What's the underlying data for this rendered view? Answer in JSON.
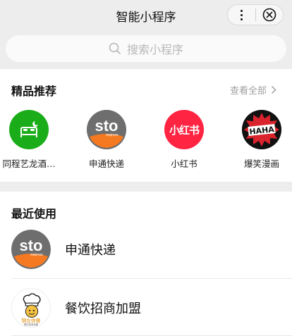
{
  "header": {
    "title": "智能小程序"
  },
  "search": {
    "placeholder": "搜索小程序"
  },
  "featured": {
    "title": "精品推荐",
    "see_all": "查看全部",
    "apps": [
      {
        "name": "同程艺龙酒…",
        "icon": "hotel-bed-icon",
        "color": "#1aad19"
      },
      {
        "name": "申通快递",
        "icon": "sto-express-logo",
        "color": "#6e6e6e"
      },
      {
        "name": "小红书",
        "icon": "xiaohongshu-logo",
        "color": "#ff2442",
        "logo_text": "小红书"
      },
      {
        "name": "爆笑漫画",
        "icon": "haha-comic-logo",
        "color": "#d9232d",
        "logo_text": "HAHA"
      }
    ]
  },
  "recent": {
    "title": "最近使用",
    "items": [
      {
        "name": "申通快递",
        "icon": "sto-express-logo"
      },
      {
        "name": "餐饮招商加盟",
        "icon": "chef-logo"
      }
    ]
  },
  "logos": {
    "sto_text": "sto",
    "sto_sub": "express",
    "chef_text": "锦左休餐",
    "chef_sub": "餐饮招商加盟"
  }
}
